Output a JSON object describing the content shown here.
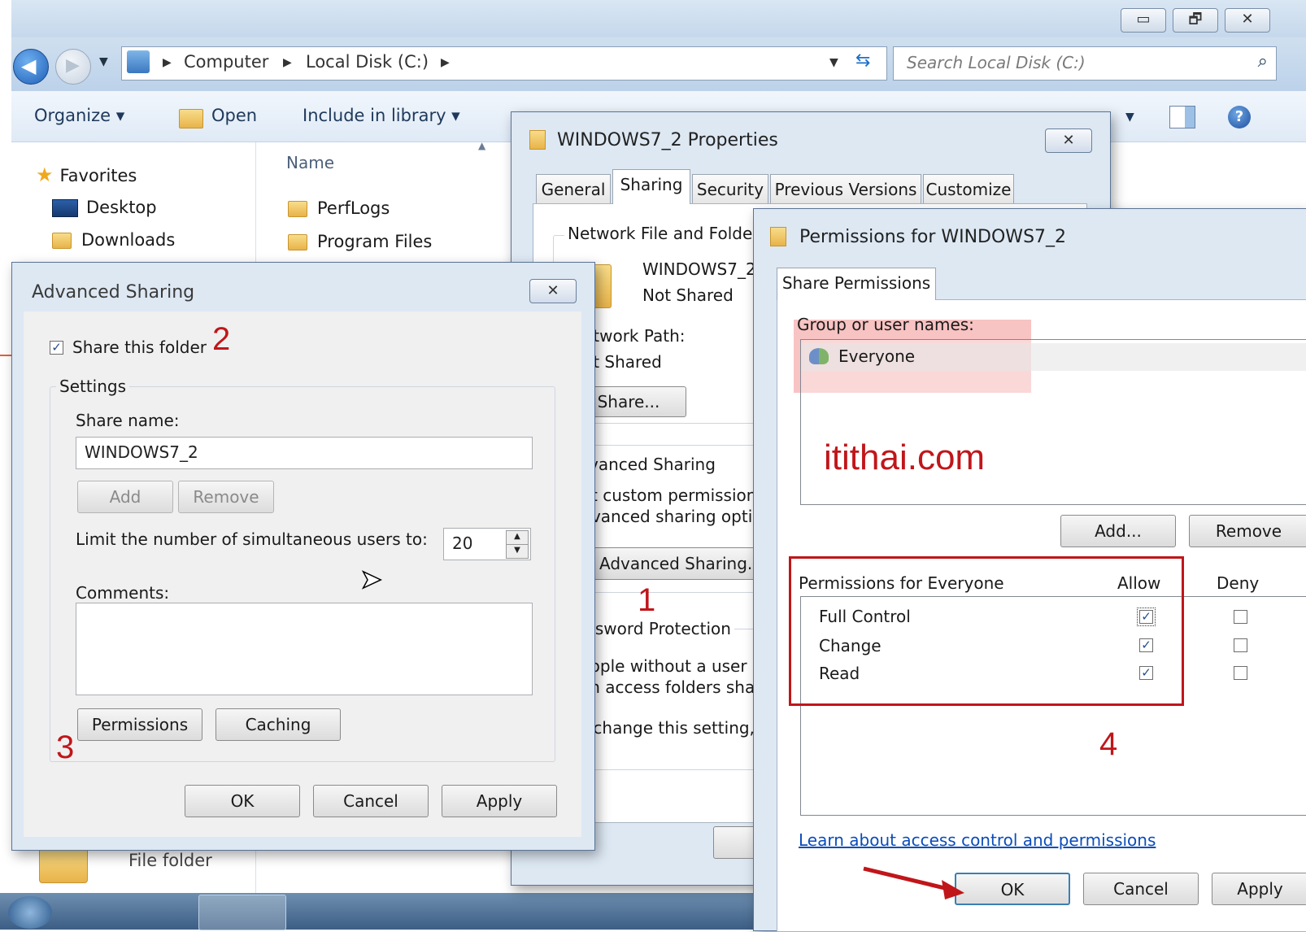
{
  "explorer": {
    "breadcrumb": [
      "Computer",
      "Local Disk (C:)"
    ],
    "search_placeholder": "Search Local Disk (C:)",
    "toolbar": {
      "organize": "Organize ▾",
      "open": "Open",
      "include": "Include in library ▾"
    },
    "nav": [
      "Favorites",
      "Desktop",
      "Downloads"
    ],
    "column_name": "Name",
    "files": [
      "PerfLogs",
      "Program Files"
    ],
    "bottom_type": "File folder",
    "caption": {
      "minimize": "▭",
      "restore": "🗗",
      "close": "✕"
    }
  },
  "properties_dialog": {
    "title": "WINDOWS7_2 Properties",
    "tabs": [
      "General",
      "Sharing",
      "Security",
      "Previous Versions",
      "Customize"
    ],
    "group_network": "Network File and Folder Sharing",
    "folder_name": "WINDOWS7_2",
    "folder_status": "Not Shared",
    "network_path_label": "Network Path:",
    "network_path_value": "Not Shared",
    "share_button": "Share...",
    "group_advanced": "Advanced Sharing",
    "advanced_text1": "Set custom permissions,",
    "advanced_text2": "advanced sharing options.",
    "advanced_button": "Advanced Sharing...",
    "group_password": "Password Protection",
    "password_text1": "People without a user account",
    "password_text2": "can access folders shared",
    "password_text3": "To change this setting, use"
  },
  "advanced_dialog": {
    "title": "Advanced Sharing",
    "share_checkbox": "Share this folder",
    "settings_label": "Settings",
    "share_name_label": "Share name:",
    "share_name_value": "WINDOWS7_2",
    "add_button": "Add",
    "remove_button": "Remove",
    "limit_label": "Limit the number of simultaneous users to:",
    "limit_value": "20",
    "comments_label": "Comments:",
    "permissions_button": "Permissions",
    "caching_button": "Caching",
    "ok": "OK",
    "cancel": "Cancel",
    "apply": "Apply"
  },
  "permissions_dialog": {
    "title": "Permissions for WINDOWS7_2",
    "tab": "Share Permissions",
    "group_label": "Group or user names:",
    "user": "Everyone",
    "watermark": "itithai.com",
    "add_button": "Add...",
    "remove_button": "Remove",
    "perm_header": "Permissions for Everyone",
    "allow_header": "Allow",
    "deny_header": "Deny",
    "permissions": [
      {
        "name": "Full Control",
        "allow": true,
        "deny": false
      },
      {
        "name": "Change",
        "allow": true,
        "deny": false
      },
      {
        "name": "Read",
        "allow": true,
        "deny": false
      }
    ],
    "link": "Learn about access control and permissions",
    "ok": "OK",
    "cancel": "Cancel",
    "apply": "Apply"
  },
  "annotations": {
    "step1": "1",
    "step2": "2",
    "step3": "3",
    "step4": "4"
  },
  "colors": {
    "annotation": "#c0161a",
    "highlight": "#f7b8b8",
    "link": "#0b4cb8"
  }
}
